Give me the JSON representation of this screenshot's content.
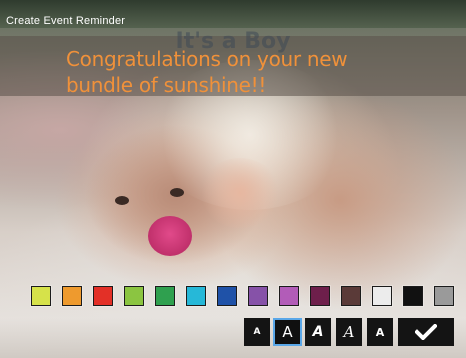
{
  "screen": {
    "title": "Create Event Reminder"
  },
  "card": {
    "heading": "It's a Boy",
    "message": "Congratulations on your new bundle of sunshine!!",
    "message_color": "#f0913a"
  },
  "palette": {
    "colors": [
      "#d6e24a",
      "#ee9a2e",
      "#e33027",
      "#8bc541",
      "#2fa04f",
      "#26b8d8",
      "#1f52a8",
      "#8652a8",
      "#b25cb8",
      "#6e1f4b",
      "#5a3a38",
      "#ececec",
      "#111111",
      "#9a9a9a"
    ]
  },
  "font_bar": {
    "styles": [
      {
        "glyph": "A",
        "name": "font-small",
        "size": "9px",
        "style": "normal",
        "weight": "bold"
      },
      {
        "glyph": "A",
        "name": "font-regular",
        "size": "15px",
        "style": "normal",
        "weight": "normal",
        "selected": true
      },
      {
        "glyph": "A",
        "name": "font-italic",
        "size": "14px",
        "style": "italic",
        "weight": "bold"
      },
      {
        "glyph": "A",
        "name": "font-script",
        "size": "15px",
        "style": "italic",
        "weight": "normal"
      },
      {
        "glyph": "A",
        "name": "font-bold",
        "size": "11px",
        "style": "normal",
        "weight": "bold"
      }
    ],
    "confirm_icon": "checkmark-icon"
  }
}
